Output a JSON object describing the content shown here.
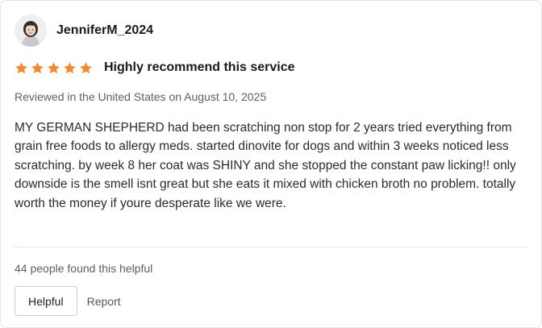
{
  "review": {
    "reviewer_name": "JenniferM_2024",
    "rating": 5,
    "rating_max": 5,
    "star_color": "#f08a30",
    "title": "Highly recommend this service",
    "meta": "Reviewed in the United States on August 10, 2025",
    "body": "MY GERMAN SHEPHERD had been scratching non stop for 2 years tried everything from grain free foods to allergy meds. started dinovite for dogs and within 3 weeks noticed less scratching. by week 8 her coat was SHINY and she stopped the constant paw licking!! only downside is the smell isnt great but she eats it mixed with chicken broth no problem. totally worth the money if youre desperate like we were.",
    "helpful_count_text": "44 people found this helpful"
  },
  "actions": {
    "helpful_label": "Helpful",
    "report_label": "Report"
  }
}
